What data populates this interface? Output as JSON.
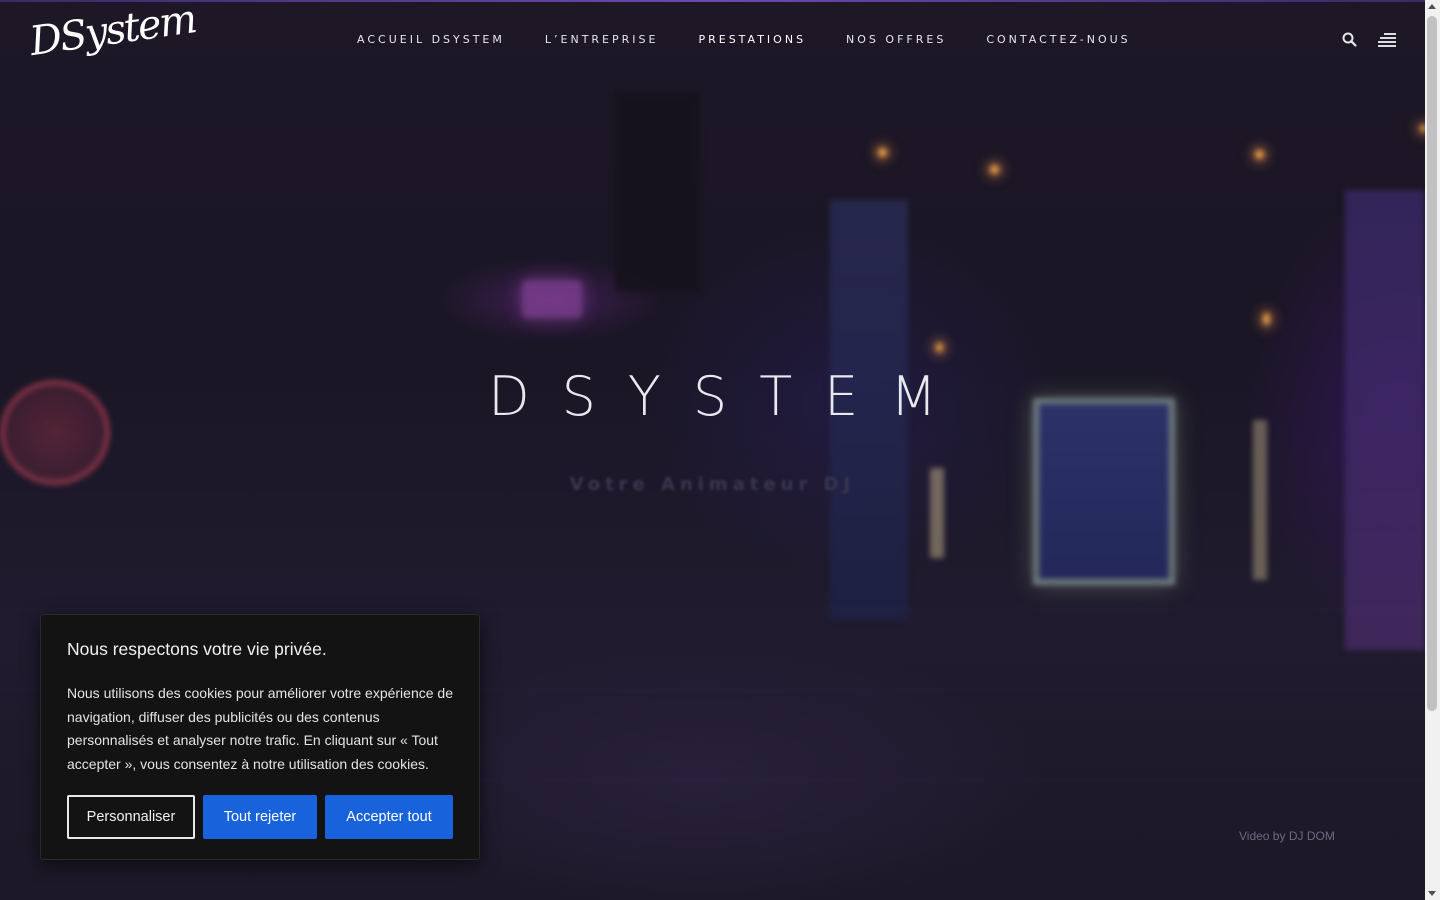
{
  "brand": {
    "logo_text": "DSystem"
  },
  "nav": {
    "items": [
      {
        "label": "ACCUEIL DSYSTEM"
      },
      {
        "label": "L’ENTREPRISE"
      },
      {
        "label": "PRESTATIONS"
      },
      {
        "label": "NOS OFFRES"
      },
      {
        "label": "CONTACTEZ-NOUS"
      }
    ],
    "search_icon": "search-icon",
    "menu_icon": "hamburger-menu-icon"
  },
  "hero": {
    "title": "DSYSTEM",
    "subtitle": "Votre Animateur DJ",
    "credit": "Video by DJ DOM"
  },
  "cookie_banner": {
    "title": "Nous respectons votre vie privée.",
    "body": "Nous utilisons des cookies pour améliorer votre expérience de navigation, diffuser des publicités ou des contenus personnalisés et analyser notre trafic. En cliquant sur « Tout accepter », vous consentez à notre utilisation des cookies.",
    "customize_label": "Personnaliser",
    "reject_label": "Tout rejeter",
    "accept_label": "Accepter tout"
  },
  "colors": {
    "accent_blue": "#1863dc",
    "banner_bg": "#131313",
    "hero_bg": "#1a1625"
  }
}
